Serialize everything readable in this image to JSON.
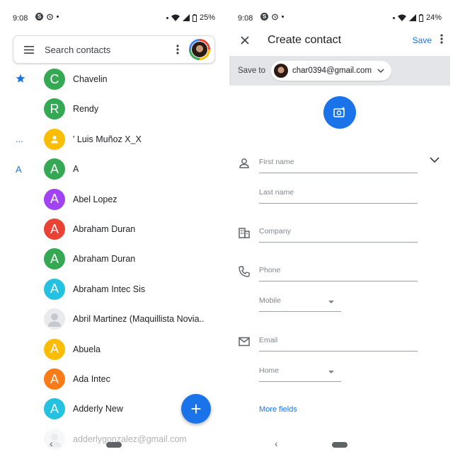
{
  "left": {
    "status": {
      "time": "9:08",
      "battery": "25%"
    },
    "search": {
      "placeholder": "Search contacts"
    },
    "contacts": [
      {
        "marker": "★",
        "letter": "C",
        "color": "#34a853",
        "name": "Chavelin"
      },
      {
        "marker": "",
        "letter": "R",
        "color": "#34a853",
        "name": "Rendy"
      },
      {
        "marker": "...",
        "letter": "",
        "color": "#fbbc04",
        "name": "' Luis Muñoz X_X"
      },
      {
        "marker": "A",
        "letter": "A",
        "color": "#34a853",
        "name": "A"
      },
      {
        "marker": "",
        "letter": "A",
        "color": "#a142f4",
        "name": "Abel Lopez"
      },
      {
        "marker": "",
        "letter": "A",
        "color": "#ea4335",
        "name": "Abraham Duran"
      },
      {
        "marker": "",
        "letter": "A",
        "color": "#34a853",
        "name": "Abraham Duran"
      },
      {
        "marker": "",
        "letter": "A",
        "color": "#24c1e0",
        "name": "Abraham Intec Sis"
      },
      {
        "marker": "",
        "letter": "",
        "color": "#e8eaed",
        "name": "Abril Martinez (Maquillista Novia.."
      },
      {
        "marker": "",
        "letter": "A",
        "color": "#fbbc04",
        "name": "Abuela"
      },
      {
        "marker": "",
        "letter": "A",
        "color": "#fa7b17",
        "name": "Ada Intec"
      },
      {
        "marker": "",
        "letter": "A",
        "color": "#24c1e0",
        "name": "Adderly New"
      },
      {
        "marker": "",
        "letter": "",
        "color": "#e8eaed",
        "name": "adderlygonzalez@gmail.com"
      }
    ],
    "fab_label": "+",
    "nav_back": "‹"
  },
  "right": {
    "status": {
      "time": "9:08",
      "battery": "24%"
    },
    "title": "Create contact",
    "save": "Save",
    "save_to_label": "Save to",
    "account": "char0394@gmail.com",
    "fields": {
      "first_name": "First name",
      "last_name": "Last name",
      "company": "Company",
      "phone": "Phone",
      "phone_type": "Mobile",
      "email": "Email",
      "email_type": "Home"
    },
    "more_fields": "More fields",
    "nav_back": "‹"
  }
}
